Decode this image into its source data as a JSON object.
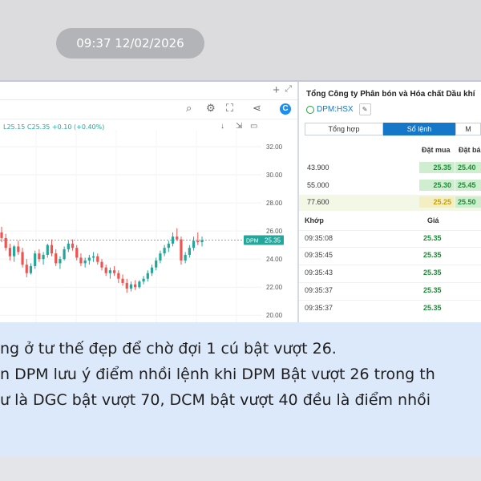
{
  "timestamp": "09:37 12/02/2026",
  "chart": {
    "ohlc": "L25.15  C25.35  +0.10 (+0.40%)",
    "price_tag": "DPM 25.35",
    "price_tag_symbol": "DPM",
    "price_tag_value": "25.35",
    "y_ticks": [
      "32.00",
      "30.00",
      "28.00",
      "26.00",
      "24.00",
      "22.00",
      "20.00"
    ],
    "last_price": 25.35,
    "ylim": [
      19.5,
      33.2
    ],
    "candles": [
      [
        25.9,
        26.3,
        25.2,
        25.5
      ],
      [
        25.5,
        25.8,
        24.6,
        24.8
      ],
      [
        24.8,
        25.1,
        23.9,
        24.2
      ],
      [
        24.2,
        25.0,
        23.8,
        24.9
      ],
      [
        24.9,
        25.3,
        24.3,
        24.5
      ],
      [
        24.5,
        24.8,
        23.4,
        23.6
      ],
      [
        23.6,
        24.0,
        22.7,
        23.0
      ],
      [
        23.0,
        23.7,
        22.9,
        23.5
      ],
      [
        23.5,
        24.6,
        23.3,
        24.4
      ],
      [
        24.4,
        24.7,
        23.8,
        24.0
      ],
      [
        24.0,
        24.5,
        23.6,
        24.3
      ],
      [
        24.3,
        25.1,
        24.1,
        25.0
      ],
      [
        25.0,
        25.4,
        24.2,
        24.4
      ],
      [
        24.4,
        24.7,
        23.5,
        23.7
      ],
      [
        23.7,
        24.2,
        23.3,
        24.0
      ],
      [
        24.0,
        24.9,
        23.9,
        24.7
      ],
      [
        24.7,
        25.3,
        24.5,
        25.1
      ],
      [
        25.1,
        25.4,
        24.6,
        24.8
      ],
      [
        24.8,
        25.0,
        23.9,
        24.1
      ],
      [
        24.1,
        24.4,
        23.5,
        23.7
      ],
      [
        23.7,
        24.1,
        23.4,
        23.9
      ],
      [
        23.9,
        24.3,
        23.6,
        24.1
      ],
      [
        24.1,
        24.5,
        23.8,
        24.2
      ],
      [
        24.2,
        24.4,
        23.6,
        23.8
      ],
      [
        23.8,
        24.0,
        23.2,
        23.4
      ],
      [
        23.4,
        23.6,
        22.8,
        23.0
      ],
      [
        23.0,
        23.4,
        22.6,
        23.2
      ],
      [
        23.2,
        23.5,
        22.8,
        23.0
      ],
      [
        23.0,
        23.2,
        22.3,
        22.6
      ],
      [
        22.6,
        22.9,
        22.1,
        22.3
      ],
      [
        22.3,
        22.6,
        21.6,
        21.9
      ],
      [
        21.9,
        22.4,
        21.7,
        22.2
      ],
      [
        22.2,
        22.5,
        21.8,
        22.0
      ],
      [
        22.0,
        22.5,
        21.9,
        22.4
      ],
      [
        22.4,
        22.8,
        22.2,
        22.6
      ],
      [
        22.6,
        23.2,
        22.4,
        23.0
      ],
      [
        23.0,
        23.6,
        22.8,
        23.4
      ],
      [
        23.4,
        24.1,
        23.2,
        23.9
      ],
      [
        23.9,
        24.6,
        23.7,
        24.4
      ],
      [
        24.4,
        25.0,
        24.2,
        24.8
      ],
      [
        24.8,
        25.3,
        24.5,
        25.1
      ],
      [
        25.1,
        25.9,
        24.9,
        25.6
      ],
      [
        25.6,
        26.2,
        25.3,
        25.4
      ],
      [
        25.4,
        25.6,
        23.6,
        23.9
      ],
      [
        23.9,
        24.5,
        23.7,
        24.3
      ],
      [
        24.3,
        25.0,
        24.1,
        24.8
      ],
      [
        24.8,
        25.6,
        24.6,
        25.3
      ],
      [
        25.3,
        25.9,
        25.0,
        25.2
      ],
      [
        25.2,
        25.6,
        24.9,
        25.35
      ]
    ]
  },
  "order_book": {
    "company": "Tổng Công ty Phân bón và Hóa chất Dầu khí",
    "ticker": "DPM:HSX",
    "tabs": [
      "Tổng hợp",
      "Sổ lệnh",
      "M"
    ],
    "col_bid": "Đặt mua",
    "col_ask": "Đặt bá",
    "rows": [
      {
        "vol": "43.900",
        "bid": "25.35",
        "ask": "25.40"
      },
      {
        "vol": "55.000",
        "bid": "25.30",
        "ask": "25.45"
      },
      {
        "vol": "77.600",
        "bid": "25.25",
        "ask": "25.50"
      }
    ],
    "match_label": "Khớp",
    "price_label": "Giá",
    "trades": [
      {
        "time": "09:35:08",
        "price": "25.35"
      },
      {
        "time": "09:35:45",
        "price": "25.35"
      },
      {
        "time": "09:35:43",
        "price": "25.35"
      },
      {
        "time": "09:35:37",
        "price": "25.35"
      },
      {
        "time": "09:35:37",
        "price": "25.35"
      }
    ]
  },
  "message": {
    "line1": "ng ở tư thế đẹp để chờ đợi 1 cú bật vượt 26.",
    "line2": "n DPM lưu ý điểm nhồi lệnh khi DPM Bật vượt 26 trong th",
    "line3": "ư là DGC bật vượt 70, DCM bật vượt 40 đều là điểm nhồi"
  },
  "colors": {
    "up": "#26a69a",
    "down": "#ef5350",
    "accent": "#1677c9"
  }
}
